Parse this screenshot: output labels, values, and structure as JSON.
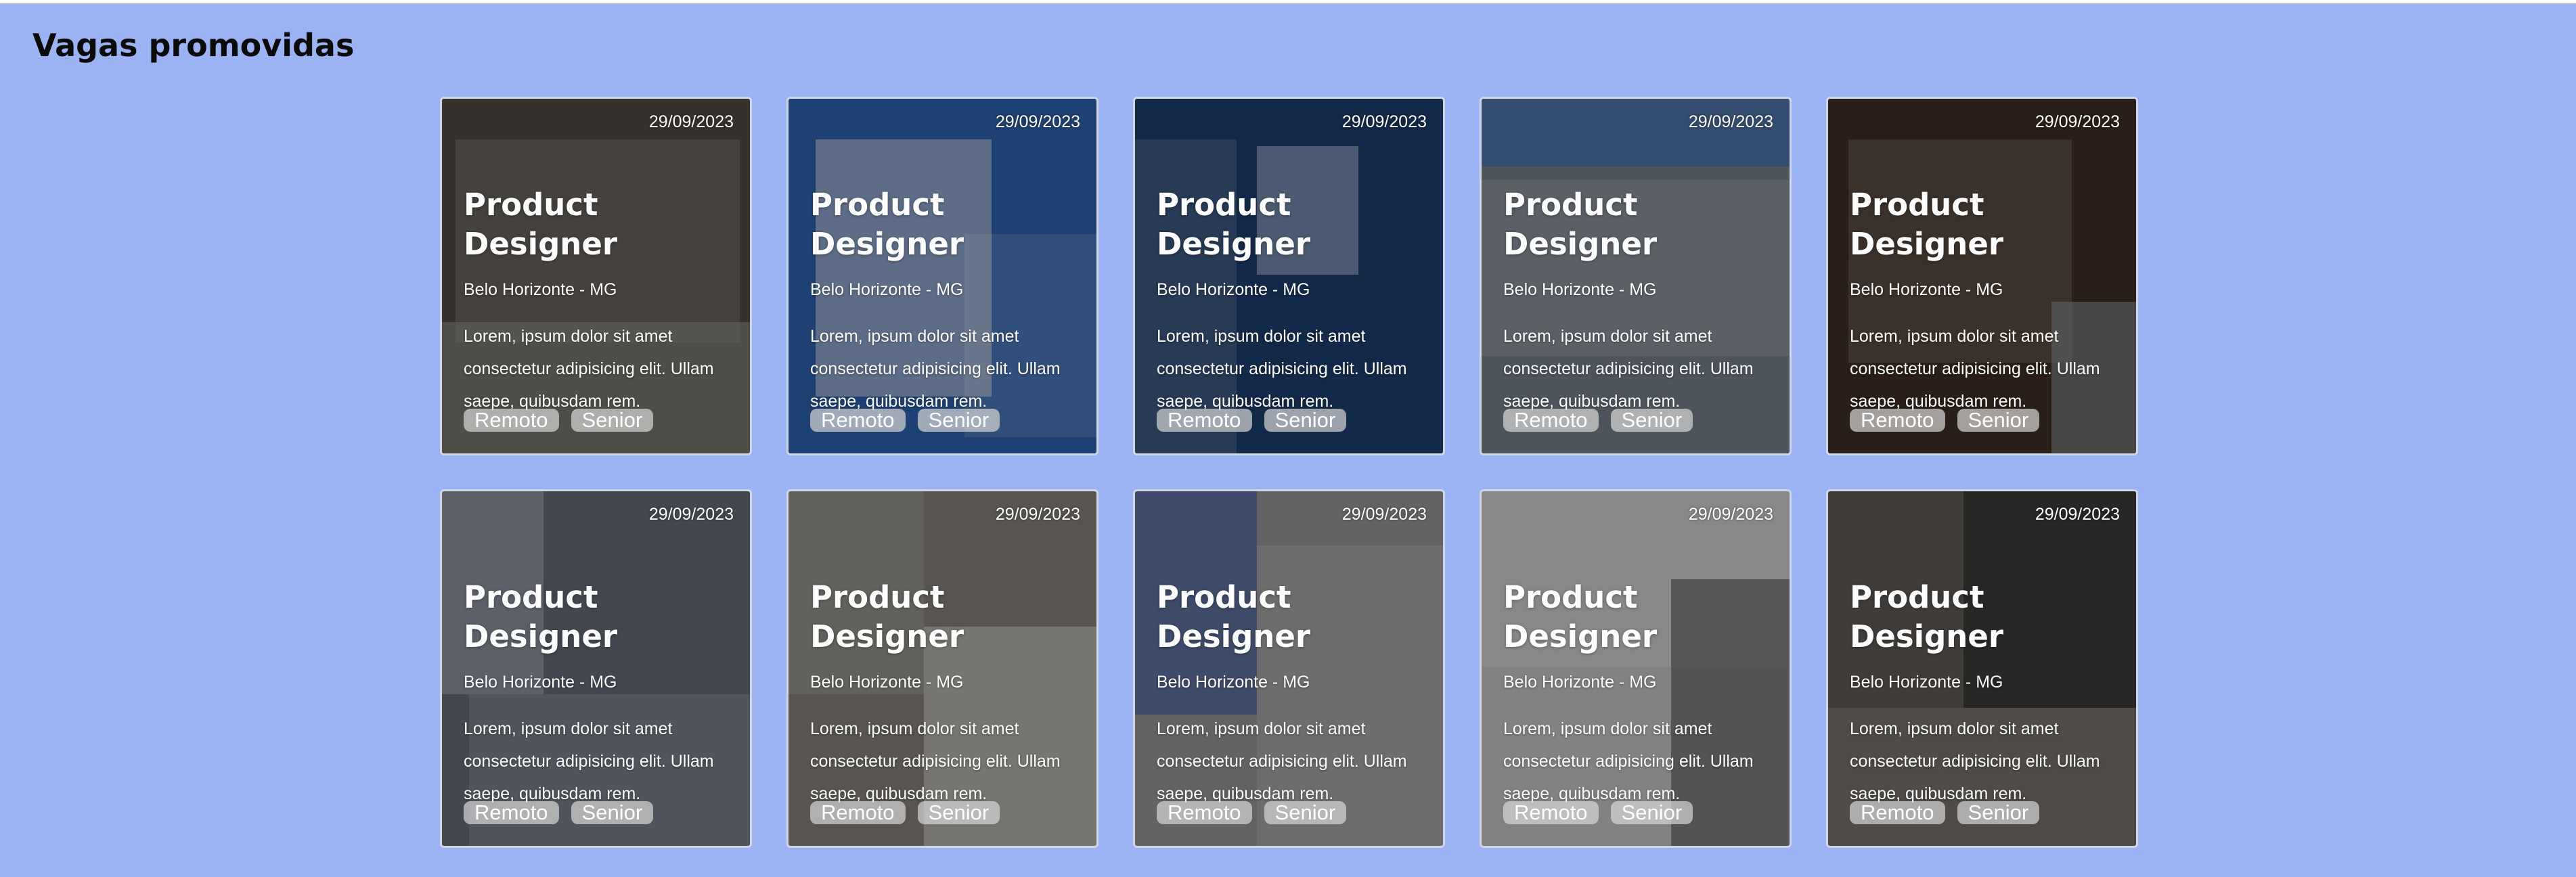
{
  "page": {
    "title": "Vagas promovidas"
  },
  "cards": [
    {
      "date": "29/09/2023",
      "title": "Product Designer",
      "location": "Belo Horizonte - MG",
      "description": "Lorem, ipsum dolor sit amet consectetur adipisicing elit. Ullam saepe, quibusdam rem.",
      "tags": [
        "Remoto",
        "Senior"
      ],
      "image": "application-form-laptop",
      "bg": "#4a4640",
      "accent": "#8d8a84"
    },
    {
      "date": "29/09/2023",
      "title": "Product Designer",
      "location": "Belo Horizonte - MG",
      "description": "Lorem, ipsum dolor sit amet consectetur adipisicing elit. Ullam saepe, quibusdam rem.",
      "tags": [
        "Remoto",
        "Senior"
      ],
      "image": "document-pen-illustration",
      "bg": "#2a5aa0",
      "accent": "#c9ccd2"
    },
    {
      "date": "29/09/2023",
      "title": "Product Designer",
      "location": "Belo Horizonte - MG",
      "description": "Lorem, ipsum dolor sit amet consectetur adipisicing elit. Ullam saepe, quibusdam rem.",
      "tags": [
        "Remoto",
        "Senior"
      ],
      "image": "man-with-documents-illustration",
      "bg": "#1b3a66",
      "accent": "#a8b4c7"
    },
    {
      "date": "29/09/2023",
      "title": "Product Designer",
      "location": "Belo Horizonte - MG",
      "description": "Lorem, ipsum dolor sit amet consectetur adipisicing elit. Ullam saepe, quibusdam rem.",
      "tags": [
        "Remoto",
        "Senior"
      ],
      "image": "apply-now-key",
      "bg": "#6d7580",
      "accent": "#2f62b8"
    },
    {
      "date": "29/09/2023",
      "title": "Product Designer",
      "location": "Belo Horizonte - MG",
      "description": "Lorem, ipsum dolor sit amet consectetur adipisicing elit. Ullam saepe, quibusdam rem.",
      "tags": [
        "Remoto",
        "Senior"
      ],
      "image": "job-application-laptop",
      "bg": "#3b2c22",
      "accent": "#8a8f96"
    },
    {
      "date": "29/09/2023",
      "title": "Product Designer",
      "location": "Belo Horizonte - MG",
      "description": "Lorem, ipsum dolor sit amet consectetur adipisicing elit. Ullam saepe, quibusdam rem.",
      "tags": [
        "Remoto",
        "Senior"
      ],
      "image": "job-search-keyboard",
      "bg": "#5d6470",
      "accent": "#9aa3ae"
    },
    {
      "date": "29/09/2023",
      "title": "Product Designer",
      "location": "Belo Horizonte - MG",
      "description": "Lorem, ipsum dolor sit amet consectetur adipisicing elit. Ullam saepe, quibusdam rem.",
      "tags": [
        "Remoto",
        "Senior"
      ],
      "image": "resume-handover",
      "bg": "#7a776f",
      "accent": "#c8c6c0"
    },
    {
      "date": "29/09/2023",
      "title": "Product Designer",
      "location": "Belo Horizonte - MG",
      "description": "Lorem, ipsum dolor sit amet consectetur adipisicing elit. Ullam saepe, quibusdam rem.",
      "tags": [
        "Remoto",
        "Senior"
      ],
      "image": "woman-with-resume",
      "bg": "#8a8a8a",
      "accent": "#2c4f9c"
    },
    {
      "date": "29/09/2023",
      "title": "Product Designer",
      "location": "Belo Horizonte - MG",
      "description": "Lorem, ipsum dolor sit amet consectetur adipisicing elit. Ullam saepe, quibusdam rem.",
      "tags": [
        "Remoto",
        "Senior"
      ],
      "image": "man-with-envelopes",
      "bg": "#b4b4b4",
      "accent": "#3b3f46"
    },
    {
      "date": "29/09/2023",
      "title": "Product Designer",
      "location": "Belo Horizonte - MG",
      "description": "Lorem, ipsum dolor sit amet consectetur adipisicing elit. Ullam saepe, quibusdam rem.",
      "tags": [
        "Remoto",
        "Senior"
      ],
      "image": "job-interview",
      "bg": "#585450",
      "accent": "#1d1d1f"
    }
  ]
}
